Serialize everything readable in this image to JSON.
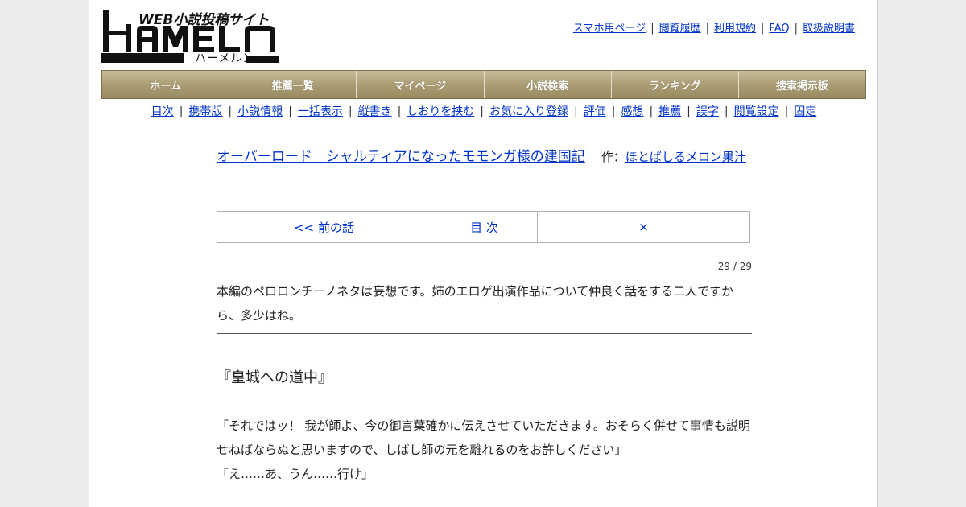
{
  "logo": {
    "tagline": "WEB小説投稿サイト",
    "wordmark": "HAMELN",
    "kana": "ハーメルン"
  },
  "top_links": [
    "スマホ用ページ",
    "閲覧履歴",
    "利用規約",
    "FAQ",
    "取扱説明書"
  ],
  "main_nav": [
    "ホーム",
    "推薦一覧",
    "マイページ",
    "小説検索",
    "ランキング",
    "捜索掲示板"
  ],
  "sub_nav": [
    "目次",
    "携帯版",
    "小説情報",
    "一括表示",
    "縦書き",
    "しおりを挟む",
    "お気に入り登録",
    "評価",
    "感想",
    "推薦",
    "誤字",
    "閲覧設定",
    "固定"
  ],
  "novel": {
    "title": "オーバーロード　シャルティアになったモモンガ様の建国記",
    "author_prefix": "作：",
    "author": "ほとばしるメロン果汁"
  },
  "chapter_nav": {
    "prev": "<< 前の話",
    "toc": "目 次",
    "next": "×"
  },
  "page_count": "29 / 29",
  "preface": "本編のペロロンチーノネタは妄想です。姉のエロゲ出演作品について仲良く話をする二人ですから、多少はね。",
  "chapter_title": "『皇城への道中』",
  "body_lines": [
    "「それではッ！ 我が師よ、今の御言葉確かに伝えさせていただきます。おそらく併せて事情も説明せねばならぬと思いますので、しばし師の元を離れるのをお許しください」",
    "「え……あ、うん……行け」"
  ],
  "colors": {
    "nav_gradient_top": "#c8bd99",
    "nav_gradient_bottom": "#9a8c60",
    "link": "#0033cc"
  }
}
